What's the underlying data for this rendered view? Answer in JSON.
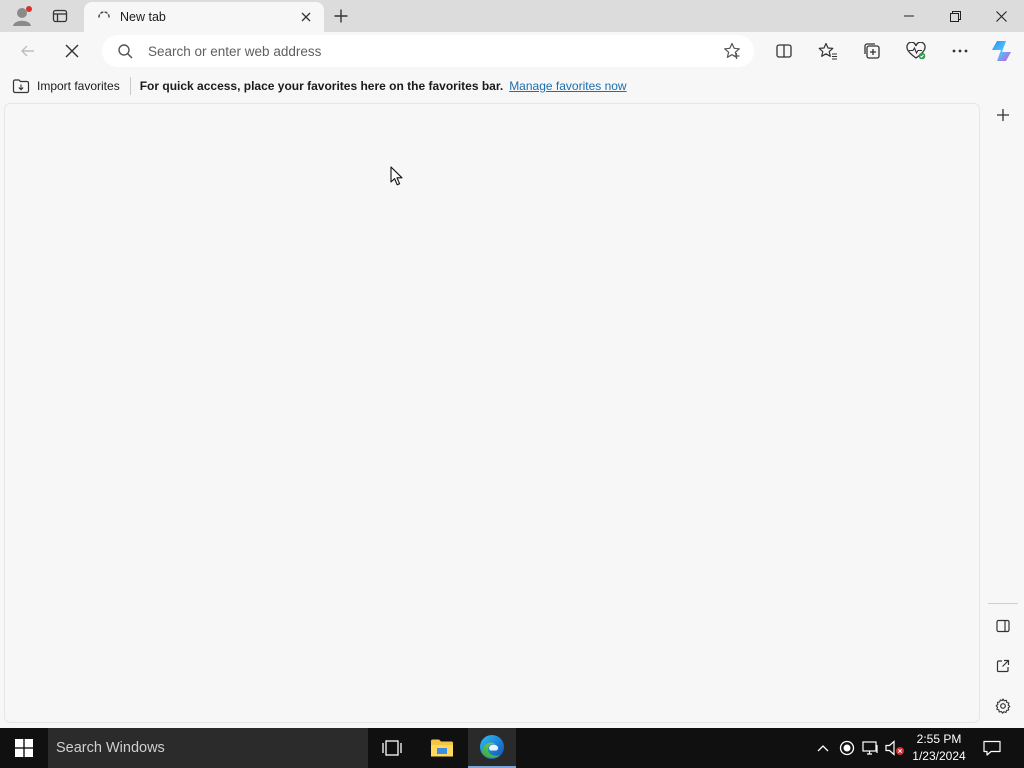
{
  "tab": {
    "title": "New tab"
  },
  "address": {
    "placeholder": "Search or enter web address"
  },
  "favorites_bar": {
    "import_label": "Import favorites",
    "message": "For quick access, place your favorites here on the favorites bar.",
    "manage_link": "Manage favorites now"
  },
  "taskbar": {
    "search_placeholder": "Search Windows",
    "time": "2:55 PM",
    "date": "1/23/2024"
  },
  "icons": {
    "profile": "profile-icon",
    "tab_actions": "tab-actions-icon",
    "loading": "loading-spinner-icon",
    "stop": "stop-loading-icon",
    "back": "back-arrow-icon",
    "split_screen": "split-screen-icon",
    "favorites": "favorites-icon",
    "collections": "collections-icon",
    "browser_essentials": "heart-pulse-icon",
    "more": "more-icon",
    "copilot": "copilot-icon"
  },
  "colors": {
    "accent_link": "#1a6fb0",
    "profile_badge": "#d6322f",
    "taskbar_bg": "#101010"
  }
}
